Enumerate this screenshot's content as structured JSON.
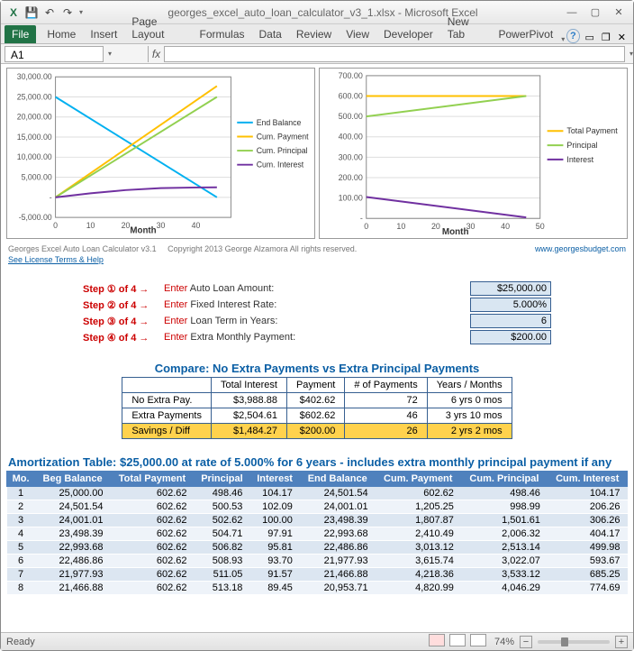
{
  "window": {
    "title": "georges_excel_auto_loan_calculator_v3_1.xlsx - Microsoft Excel",
    "qat": [
      "excel",
      "save",
      "undo",
      "redo"
    ],
    "min": "—",
    "max": "▢",
    "close": "✕"
  },
  "ribbon": {
    "file": "File",
    "tabs": [
      "Home",
      "Insert",
      "Page Layout",
      "Formulas",
      "Data",
      "Review",
      "View",
      "Developer",
      "New Tab",
      "PowerPivot"
    ]
  },
  "formula_bar": {
    "name_box": "A1",
    "fx": "fx"
  },
  "chart_data": [
    {
      "type": "line",
      "xlabel": "Month",
      "x_ticks": [
        0,
        10,
        20,
        30,
        40
      ],
      "y_ticks": [
        -5000,
        0,
        5000,
        10000,
        15000,
        20000,
        25000,
        30000
      ],
      "y_tick_labels": [
        "-5,000.00",
        "-",
        "5,000.00",
        "10,000.00",
        "15,000.00",
        "20,000.00",
        "25,000.00",
        "30,000.00"
      ],
      "xlim": [
        0,
        50
      ],
      "ylim": [
        -5000,
        30000
      ],
      "series": [
        {
          "name": "End Balance",
          "color": "#00b0f0",
          "x": [
            0,
            46
          ],
          "y": [
            25000,
            0
          ]
        },
        {
          "name": "Cum. Payment",
          "color": "#ffc000",
          "x": [
            0,
            46
          ],
          "y": [
            0,
            27700
          ]
        },
        {
          "name": "Cum. Principal",
          "color": "#92d050",
          "x": [
            0,
            46
          ],
          "y": [
            0,
            25000
          ]
        },
        {
          "name": "Cum. Interest",
          "color": "#7030a0",
          "x": [
            0,
            10,
            20,
            30,
            40,
            46
          ],
          "y": [
            0,
            1000,
            1800,
            2300,
            2450,
            2500
          ]
        }
      ]
    },
    {
      "type": "line",
      "xlabel": "Month",
      "x_ticks": [
        0,
        10,
        20,
        30,
        40,
        50
      ],
      "y_ticks": [
        0,
        100,
        200,
        300,
        400,
        500,
        600,
        700
      ],
      "y_tick_labels": [
        "-",
        "100.00",
        "200.00",
        "300.00",
        "400.00",
        "500.00",
        "600.00",
        "700.00"
      ],
      "xlim": [
        0,
        50
      ],
      "ylim": [
        0,
        700
      ],
      "series": [
        {
          "name": "Total Payment",
          "color": "#ffc000",
          "x": [
            0,
            46
          ],
          "y": [
            600,
            600
          ]
        },
        {
          "name": "Principal",
          "color": "#92d050",
          "x": [
            0,
            46
          ],
          "y": [
            500,
            600
          ]
        },
        {
          "name": "Interest",
          "color": "#7030a0",
          "x": [
            0,
            46
          ],
          "y": [
            105,
            5
          ]
        }
      ]
    }
  ],
  "branding": {
    "product": "Georges Excel Auto Loan Calculator v3.1",
    "copyright": "Copyright 2013  George Alzamora  All rights reserved.",
    "site": "www.georgesbudget.com",
    "license": "See License Terms & Help"
  },
  "steps": [
    {
      "step": "Step ① of 4 →",
      "enter": "Enter",
      "field": "Auto Loan Amount:",
      "value": "$25,000.00"
    },
    {
      "step": "Step ② of 4 →",
      "enter": "Enter",
      "field": "Fixed Interest Rate:",
      "value": "5.000%"
    },
    {
      "step": "Step ③ of 4 →",
      "enter": "Enter",
      "field": "Loan Term in Years:",
      "value": "6"
    },
    {
      "step": "Step ④ of 4 →",
      "enter": "Enter",
      "field": "Extra Monthly Payment:",
      "value": "$200.00"
    }
  ],
  "compare": {
    "title": "Compare: No Extra Payments vs Extra Principal Payments",
    "headers": [
      "",
      "Total Interest",
      "Payment",
      "# of Payments",
      "Years / Months"
    ],
    "rows": [
      {
        "label": "No Extra Pay.",
        "cells": [
          "$3,988.88",
          "$402.62",
          "72",
          "6 yrs 0 mos"
        ]
      },
      {
        "label": "Extra Payments",
        "cells": [
          "$2,504.61",
          "$602.62",
          "46",
          "3 yrs 10 mos"
        ]
      },
      {
        "label": "Savings / Diff",
        "cells": [
          "$1,484.27",
          "$200.00",
          "26",
          "2 yrs 2 mos"
        ],
        "diff": true
      }
    ]
  },
  "amort": {
    "title": "Amortization Table:  $25,000.00 at rate of 5.000% for 6 years - includes extra monthly principal payment if any",
    "headers": [
      "Mo.",
      "Beg Balance",
      "Total Payment",
      "Principal",
      "Interest",
      "End Balance",
      "Cum. Payment",
      "Cum. Principal",
      "Cum. Interest"
    ],
    "rows": [
      [
        "1",
        "25,000.00",
        "602.62",
        "498.46",
        "104.17",
        "24,501.54",
        "602.62",
        "498.46",
        "104.17"
      ],
      [
        "2",
        "24,501.54",
        "602.62",
        "500.53",
        "102.09",
        "24,001.01",
        "1,205.25",
        "998.99",
        "206.26"
      ],
      [
        "3",
        "24,001.01",
        "602.62",
        "502.62",
        "100.00",
        "23,498.39",
        "1,807.87",
        "1,501.61",
        "306.26"
      ],
      [
        "4",
        "23,498.39",
        "602.62",
        "504.71",
        "97.91",
        "22,993.68",
        "2,410.49",
        "2,006.32",
        "404.17"
      ],
      [
        "5",
        "22,993.68",
        "602.62",
        "506.82",
        "95.81",
        "22,486.86",
        "3,013.12",
        "2,513.14",
        "499.98"
      ],
      [
        "6",
        "22,486.86",
        "602.62",
        "508.93",
        "93.70",
        "21,977.93",
        "3,615.74",
        "3,022.07",
        "593.67"
      ],
      [
        "7",
        "21,977.93",
        "602.62",
        "511.05",
        "91.57",
        "21,466.88",
        "4,218.36",
        "3,533.12",
        "685.25"
      ],
      [
        "8",
        "21,466.88",
        "602.62",
        "513.18",
        "89.45",
        "20,953.71",
        "4,820.99",
        "4,046.29",
        "774.69"
      ]
    ]
  },
  "statusbar": {
    "ready": "Ready",
    "zoom": "74%",
    "minus": "−",
    "plus": "+"
  }
}
